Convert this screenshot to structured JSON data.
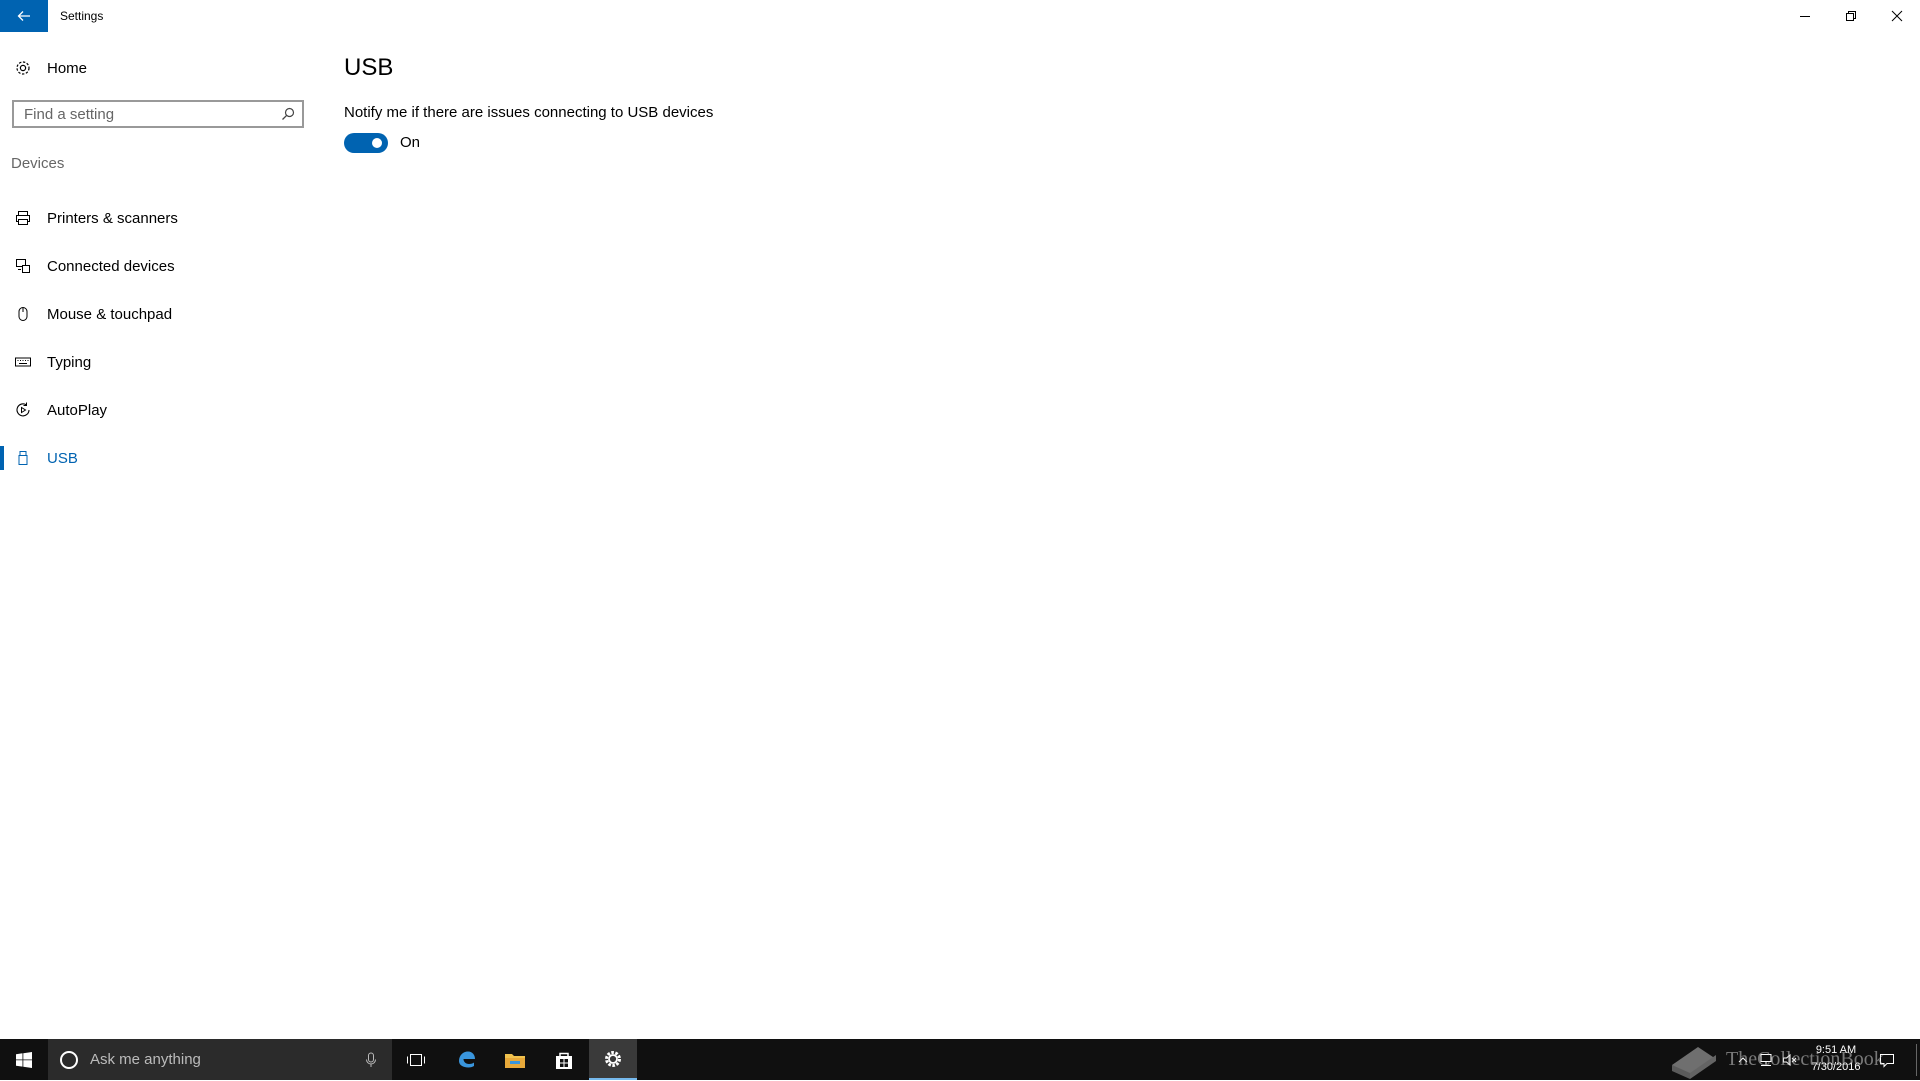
{
  "window": {
    "title": "Settings"
  },
  "sidebar": {
    "home_label": "Home",
    "search_placeholder": "Find a setting",
    "section_label": "Devices",
    "items": [
      {
        "label": "Printers & scanners",
        "icon": "printer-icon"
      },
      {
        "label": "Connected devices",
        "icon": "connected-devices-icon"
      },
      {
        "label": "Mouse & touchpad",
        "icon": "mouse-icon"
      },
      {
        "label": "Typing",
        "icon": "keyboard-icon"
      },
      {
        "label": "AutoPlay",
        "icon": "autoplay-icon"
      },
      {
        "label": "USB",
        "icon": "usb-icon",
        "selected": true
      }
    ]
  },
  "main": {
    "title": "USB",
    "setting": {
      "description": "Notify me if there are issues connecting to USB devices",
      "toggle_on": true,
      "toggle_state_label": "On"
    }
  },
  "taskbar": {
    "search_placeholder": "Ask me anything",
    "apps": [
      "task-view-icon",
      "edge-icon",
      "file-explorer-icon",
      "store-icon",
      "settings-icon"
    ],
    "active_app": "settings-icon",
    "clock": {
      "time": "9:51 AM",
      "date": "7/30/2016"
    },
    "watermark": "TheCollectionBook"
  },
  "colors": {
    "accent": "#0063b1",
    "taskbar": "#101010",
    "taskbar_search": "#2b2b2b"
  }
}
